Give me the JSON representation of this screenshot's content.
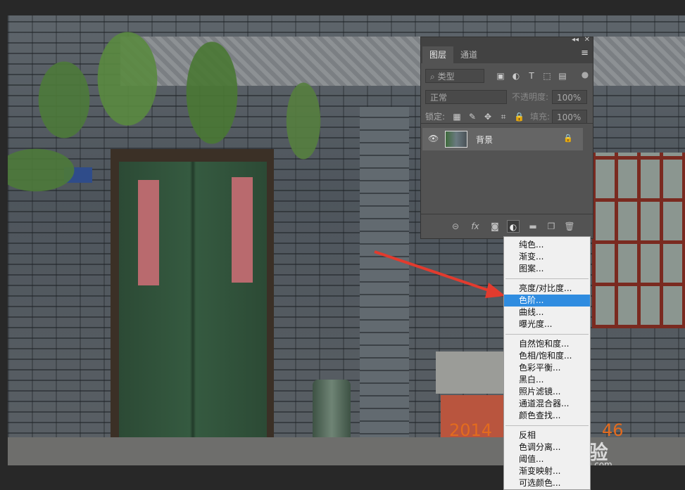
{
  "photo": {
    "year_text": "2014",
    "tail_text": "46"
  },
  "watermark": {
    "logo": "Bai 经验",
    "url": "jingyan.baidu.com"
  },
  "layers_panel": {
    "collapse_glyph": "◂◂",
    "close_glyph": "✕",
    "menu_glyph": "≡",
    "tabs": [
      {
        "label": "图层",
        "active": true
      },
      {
        "label": "通道",
        "active": false
      }
    ],
    "filter_placeholder": "类型",
    "blend_mode": "正常",
    "opacity_label": "不透明度:",
    "opacity_value": "100%",
    "lock_label": "锁定:",
    "fill_label": "填充:",
    "fill_value": "100%",
    "layer": {
      "name": "背景",
      "visible_glyph": "👁",
      "lock_glyph": "🔒"
    },
    "footer_icons": [
      "link-icon",
      "fx-icon",
      "mask-icon",
      "adjustment-icon",
      "folder-icon",
      "new-layer-icon",
      "trash-icon"
    ],
    "fx_label": "fx"
  },
  "adjustment_menu": {
    "groups": [
      [
        "纯色...",
        "渐变...",
        "图案..."
      ],
      [
        "亮度/对比度...",
        "色阶...",
        "曲线...",
        "曝光度..."
      ],
      [
        "自然饱和度...",
        "色相/饱和度...",
        "色彩平衡...",
        "黑白...",
        "照片滤镜...",
        "通道混合器...",
        "颜色查找..."
      ],
      [
        "反相",
        "色调分离...",
        "阈值...",
        "渐变映射...",
        "可选颜色..."
      ]
    ],
    "highlighted": "色阶...",
    "highlight_color": "#2f8ce0"
  },
  "colors": {
    "panel_bg": "#535353",
    "arrow": "#e23b2e"
  }
}
